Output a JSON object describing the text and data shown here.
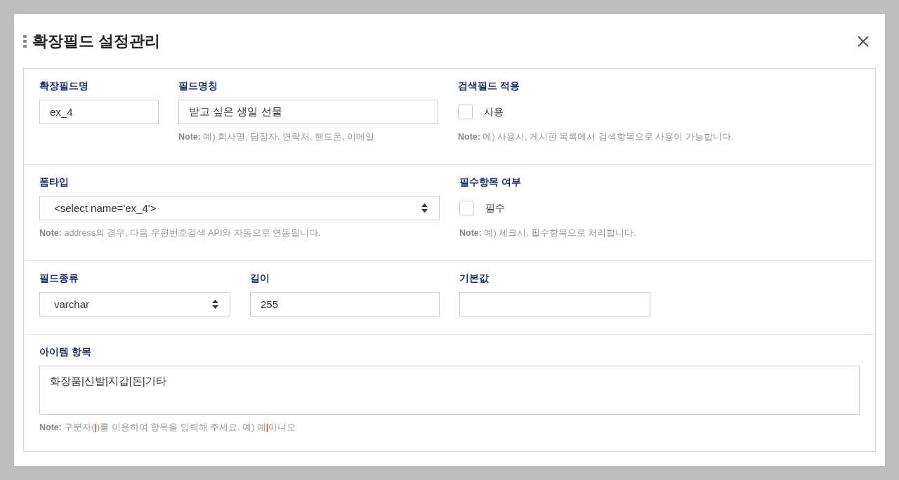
{
  "dialog": {
    "title": "확장필드 설정관리"
  },
  "sections": [
    {
      "fields": [
        {
          "kind": "text",
          "label": "확장필드명",
          "value": "ex_4"
        },
        {
          "kind": "text",
          "label": "필드명칭",
          "value": "받고 싶은 생일 선물",
          "note": [
            {
              "text": "**Note:** 예) 회사명, 담장자, 연락처, 핸드폰, 이메일",
              "accent": false
            }
          ]
        },
        {
          "kind": "checkbox",
          "label": "검색필드 적용",
          "option": "사용",
          "checked": false,
          "note": [
            {
              "text": "**Note:** 예) 사용시, 게시판 목록에서 검색항목으로 사용이 가능합니다.",
              "accent": false
            }
          ]
        }
      ]
    },
    {
      "fields": [
        {
          "kind": "select",
          "label": "폼타입",
          "value": "<select name='ex_4'>",
          "note": [
            {
              "text": "**Note:** address의 경우, 다음 우편번호검색 API와 자동으로 연동됩니다.",
              "accent": false
            }
          ]
        },
        {
          "kind": "checkbox",
          "label": "필수항목 여부",
          "option": "필수",
          "checked": false,
          "note": [
            {
              "text": "**Note:** 예) 체크시, 필수항목으로 처리합니다.",
              "accent": false
            }
          ]
        }
      ]
    },
    {
      "fields": [
        {
          "kind": "select",
          "label": "필드종류",
          "value": "varchar"
        },
        {
          "kind": "text",
          "label": "길이",
          "value": "255"
        },
        {
          "kind": "text",
          "label": "기본값"
        }
      ]
    },
    {
      "fields": [
        {
          "kind": "textarea",
          "label": "아이템 항목",
          "value": "화장품|신발|지갑|돈|기타",
          "note": [
            {
              "text": "**Note:** 구분자(",
              "accent": false
            },
            {
              "text": "|",
              "accent": true
            },
            {
              "text": ")를 이용하여 항목을 입력해 주세요. 예) 예",
              "accent": false
            },
            {
              "text": "|",
              "accent": true
            },
            {
              "text": "아니오",
              "accent": false
            }
          ]
        }
      ]
    }
  ]
}
